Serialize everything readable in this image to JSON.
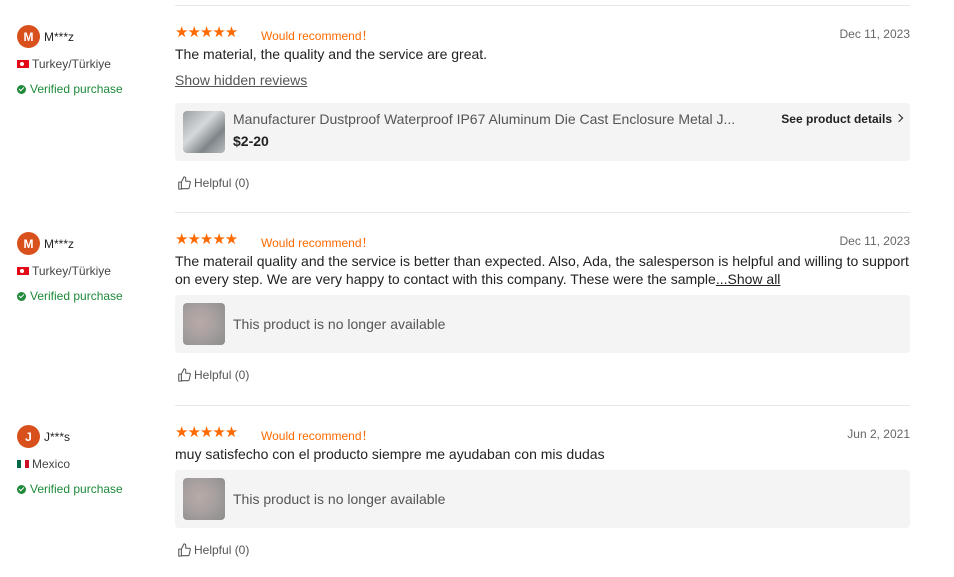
{
  "icons": {
    "star": "star-icon",
    "thumbs_up": "thumbs-up-icon",
    "verified": "check-circle-icon",
    "chevron": "chevron-right-icon"
  },
  "colors": {
    "accent": "#ff6a00",
    "avatar": "#d8501c",
    "verified": "#1f8a3a"
  },
  "reviews": [
    {
      "avatar_letter": "M",
      "username": "M***z",
      "country": "Turkey/Türkiye",
      "verified": "Verified purchase",
      "stars": "★★★★★",
      "rating": 5,
      "recommend": "Would recommend！",
      "date": "Dec 11, 2023",
      "text": "The material, the quality and the service are great.",
      "show_hidden": "Show hidden reviews",
      "product_title": "Manufacturer Dustproof Waterproof IP67 Aluminum Die Cast Enclosure Metal J...",
      "product_price": "$2-20",
      "see_details": "See product details",
      "helpful": "Helpful (0)"
    },
    {
      "avatar_letter": "M",
      "username": "M***z",
      "country": "Turkey/Türkiye",
      "verified": "Verified purchase",
      "stars": "★★★★★",
      "rating": 5,
      "recommend": "Would recommend！",
      "date": "Dec 11, 2023",
      "text": "The materail quality and the service is better than expected. Also, Ada, the salesperson is helpful and willing to support on every step. We are very happy to contact with this company. These were the sample",
      "show_all": "...Show all",
      "product_unavailable": "This product is no longer available",
      "helpful": "Helpful (0)"
    },
    {
      "avatar_letter": "J",
      "username": "J***s",
      "country": "Mexico",
      "verified": "Verified purchase",
      "stars": "★★★★★",
      "rating": 5,
      "recommend": "Would recommend！",
      "date": "Jun 2, 2021",
      "text": "muy satisfecho con el producto siempre me ayudaban con mis dudas",
      "product_unavailable": "This product is no longer available",
      "helpful": "Helpful (0)"
    }
  ]
}
